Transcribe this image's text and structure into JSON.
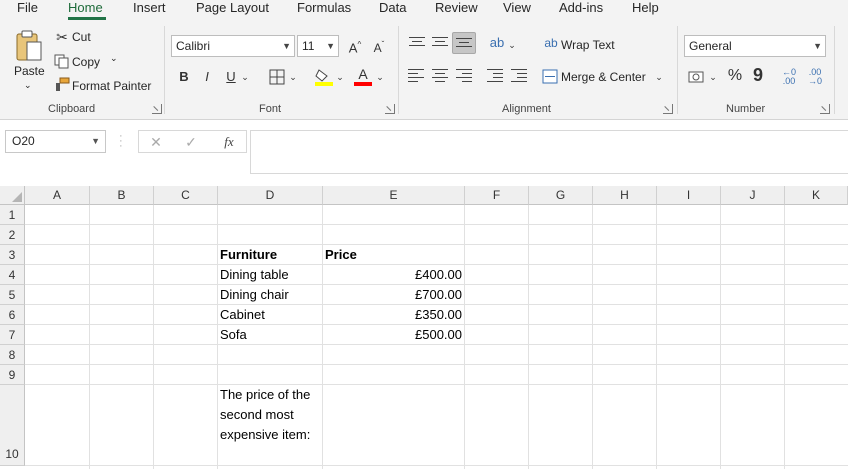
{
  "menu_tabs": [
    "File",
    "Home",
    "Insert",
    "Page Layout",
    "Formulas",
    "Data",
    "Review",
    "View",
    "Add-ins",
    "Help"
  ],
  "active_tab": "Home",
  "ribbon": {
    "clipboard": {
      "paste": "Paste",
      "cut": "Cut",
      "copy": "Copy",
      "format_painter": "Format Painter",
      "label": "Clipboard"
    },
    "font": {
      "name": "Calibri",
      "size": "11",
      "bold": "B",
      "italic": "I",
      "underline": "U",
      "label": "Font"
    },
    "alignment": {
      "wrap_text": "Wrap Text",
      "merge_center": "Merge & Center",
      "label": "Alignment"
    },
    "number": {
      "format": "General",
      "percent": "%",
      "comma": "9",
      "label": "Number"
    }
  },
  "formula_bar": {
    "name_box": "O20",
    "fx": "fx",
    "formula": ""
  },
  "columns": [
    "A",
    "B",
    "C",
    "D",
    "E",
    "F",
    "G",
    "H",
    "I",
    "J",
    "K"
  ],
  "rows": [
    "1",
    "2",
    "3",
    "4",
    "5",
    "6",
    "7",
    "8",
    "9",
    "10"
  ],
  "table": {
    "headers": [
      "Furniture",
      "Price"
    ],
    "items": [
      {
        "name": "Dining table",
        "price": "£400.00"
      },
      {
        "name": "Dining chair",
        "price": "£700.00"
      },
      {
        "name": "Cabinet",
        "price": "£350.00"
      },
      {
        "name": "Sofa",
        "price": "£500.00"
      }
    ]
  },
  "note_cell": "The price of the second most expensive item:",
  "colors": {
    "accent": "#217346",
    "ribbon_bg": "#f3f3f3",
    "highlight_yellow": "#ffff00",
    "font_red": "#ff0000"
  }
}
